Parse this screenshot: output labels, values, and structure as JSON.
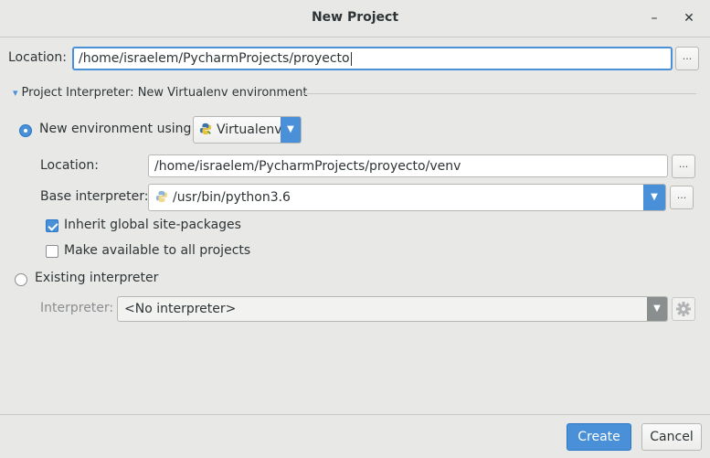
{
  "window": {
    "title": "New Project",
    "minimize_label": "–",
    "close_label": "✕"
  },
  "location": {
    "label": "Location:",
    "value": "/home/israelem/PycharmProjects/proyecto",
    "browse_label": "..."
  },
  "interpreter_section": {
    "expand_icon": "▾",
    "header": "Project Interpreter: New Virtualenv environment"
  },
  "new_env": {
    "radio_label": "New environment using",
    "selected": true,
    "tool": "Virtualenv",
    "location_label": "Location:",
    "location_value": "/home/israelem/PycharmProjects/proyecto/venv",
    "location_browse": "...",
    "base_label": "Base interpreter:",
    "base_value": "/usr/bin/python3.6",
    "base_browse": "...",
    "inherit_label": "Inherit global site-packages",
    "inherit_checked": true,
    "all_projects_label": "Make available to all projects",
    "all_projects_checked": false
  },
  "existing": {
    "radio_label": "Existing interpreter",
    "selected": false,
    "interpreter_label": "Interpreter:",
    "interpreter_value": "<No interpreter>"
  },
  "footer": {
    "create_label": "Create",
    "cancel_label": "Cancel"
  },
  "colors": {
    "accent": "#4a90d9",
    "background": "#e8e8e7",
    "text": "#2e3436",
    "disabled_text": "#8b8e8f"
  },
  "icons": {
    "python": "python-icon",
    "gear": "gear-icon",
    "dropdown": "chevron-down-icon"
  }
}
